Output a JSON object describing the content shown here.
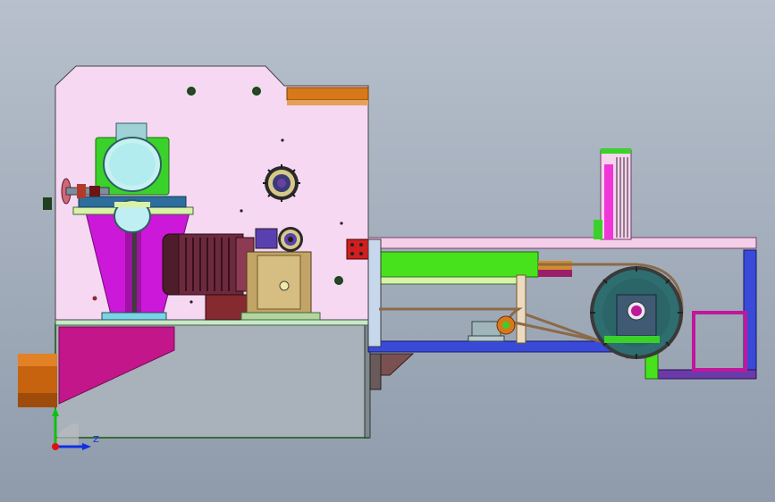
{
  "viewport": {
    "background_top": "#b7c0cc",
    "background_bottom": "#8f9bab"
  },
  "axis_triad": {
    "x_label": "",
    "y_label": "",
    "z_label": "Z",
    "x_color": "#e01010",
    "y_color": "#10c010",
    "z_color": "#1030e0"
  },
  "model": {
    "icons": [
      "machine-frame-icon",
      "motor-icon",
      "gear-icon",
      "belt-drive-icon",
      "hopper-icon",
      "handwheel-icon",
      "pulley-icon",
      "bearing-block-icon"
    ]
  }
}
